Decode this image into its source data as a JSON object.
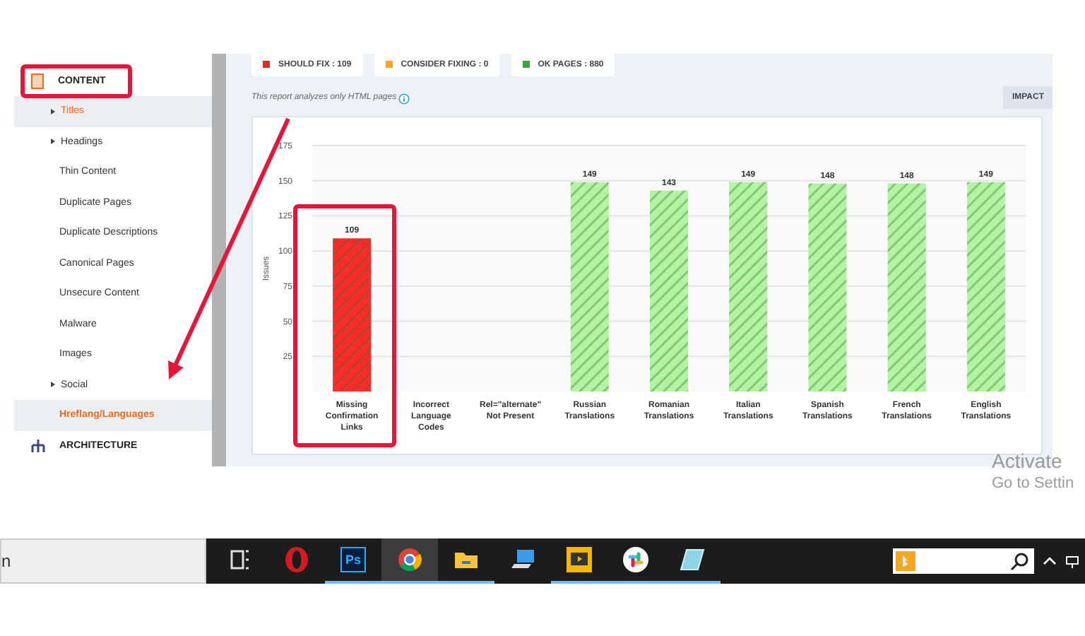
{
  "sidebar": {
    "section": {
      "label": "CONTENT"
    },
    "items": [
      {
        "label": "Titles",
        "kind": "expandable",
        "selected": true
      },
      {
        "label": "Headings",
        "kind": "expandable",
        "selected": false
      },
      {
        "label": "Thin Content",
        "kind": "link",
        "selected": false
      },
      {
        "label": "Duplicate Pages",
        "kind": "link",
        "selected": false
      },
      {
        "label": "Duplicate Descriptions",
        "kind": "link",
        "selected": false
      },
      {
        "label": "Canonical Pages",
        "kind": "link",
        "selected": false
      },
      {
        "label": "Unsecure Content",
        "kind": "link",
        "selected": false
      },
      {
        "label": "Malware",
        "kind": "link",
        "selected": false
      },
      {
        "label": "Images",
        "kind": "link",
        "selected": false
      },
      {
        "label": "Social",
        "kind": "expandable",
        "selected": false
      },
      {
        "label": "Hreflang/Languages",
        "kind": "link",
        "selected": true
      }
    ],
    "next_section": {
      "label": "ARCHITECTURE"
    }
  },
  "summary": [
    {
      "label": "SHOULD FIX : 109",
      "color": "#e8262b"
    },
    {
      "label": "CONSIDER FIXING : 0",
      "color": "#f5a623"
    },
    {
      "label": "OK PAGES : 880",
      "color": "#3aa53a"
    }
  ],
  "note": "This report analyzes only HTML pages",
  "impact_button": "IMPACT",
  "chart_data": {
    "type": "bar",
    "ylabel": "Issues",
    "categories": [
      "Missing Confirmation Links",
      "Incorrect Language Codes",
      "Rel=\"alternate\" Not Present",
      "Russian Translations",
      "Romanian Translations",
      "Italian Translations",
      "Spanish Translations",
      "French Translations",
      "English Translations"
    ],
    "values": [
      109,
      null,
      null,
      149,
      143,
      149,
      148,
      148,
      149
    ],
    "ylim": [
      0,
      175
    ],
    "yticks": [
      25,
      50,
      75,
      100,
      125,
      150,
      175
    ],
    "grid": true,
    "data_labels": true
  },
  "windows_notice": {
    "title": "Activate",
    "subtitle": "Go to Settin"
  },
  "taskbar": {
    "search_text": "n",
    "apps": [
      {
        "kind": "taskview",
        "running": false,
        "active": false
      },
      {
        "kind": "opera",
        "running": false,
        "active": false
      },
      {
        "kind": "photoshop",
        "label": "Ps",
        "running": true,
        "active": false
      },
      {
        "kind": "chrome",
        "running": true,
        "active": true
      },
      {
        "kind": "folder",
        "running": true,
        "active": false
      },
      {
        "kind": "computer",
        "running": false,
        "active": false
      },
      {
        "kind": "media",
        "running": true,
        "active": false
      },
      {
        "kind": "slack",
        "running": true,
        "active": false
      },
      {
        "kind": "notebook",
        "running": true,
        "active": false
      }
    ]
  }
}
